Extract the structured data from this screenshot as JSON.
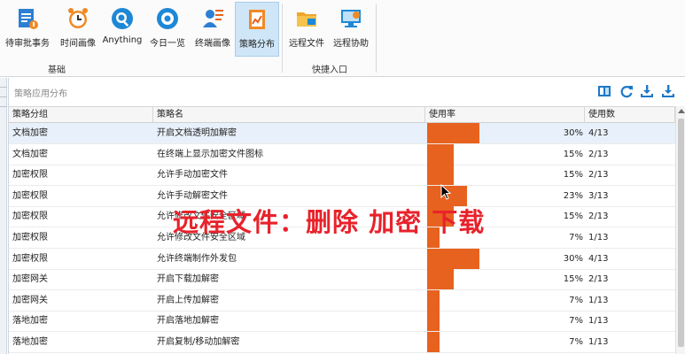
{
  "ribbon": {
    "buttons": [
      {
        "label": "待审批事务",
        "icon": "approval-tasks-icon"
      },
      {
        "label": "时间画像",
        "icon": "alarm-clock-icon"
      },
      {
        "label": "Anything",
        "icon": "search-document-icon"
      },
      {
        "label": "今日一览",
        "icon": "eye-icon"
      },
      {
        "label": "终端画像",
        "icon": "terminal-profile-icon"
      },
      {
        "label": "策略分布",
        "icon": "strategy-chart-icon"
      },
      {
        "label": "远程文件",
        "icon": "remote-folder-icon"
      },
      {
        "label": "远程协助",
        "icon": "remote-assist-icon"
      }
    ],
    "group_basic": "基础",
    "group_shortcut": "快捷入口"
  },
  "panel": {
    "title": "策略应用分布",
    "columns": [
      "策略分组",
      "策略名",
      "使用率",
      "使用数"
    ],
    "rows": [
      {
        "group": "文档加密",
        "name": "开启文档透明加解密",
        "rate": 0.3,
        "rate_label": "30%",
        "count": "4/13"
      },
      {
        "group": "文档加密",
        "name": "在终端上显示加密文件图标",
        "rate": 0.15,
        "rate_label": "15%",
        "count": "2/13"
      },
      {
        "group": "加密权限",
        "name": "允许手动加密文件",
        "rate": 0.15,
        "rate_label": "15%",
        "count": "2/13"
      },
      {
        "group": "加密权限",
        "name": "允许手动解密文件",
        "rate": 0.23,
        "rate_label": "23%",
        "count": "3/13"
      },
      {
        "group": "加密权限",
        "name": "允许修改文件安全区域",
        "rate": 0.15,
        "rate_label": "15%",
        "count": "2/13"
      },
      {
        "group": "加密权限",
        "name": "允许修改文件安全区域",
        "rate": 0.07,
        "rate_label": "7%",
        "count": "1/13"
      },
      {
        "group": "加密权限",
        "name": "允许终端制作外发包",
        "rate": 0.3,
        "rate_label": "30%",
        "count": "4/13"
      },
      {
        "group": "加密网关",
        "name": "开启下载加解密",
        "rate": 0.15,
        "rate_label": "15%",
        "count": "2/13"
      },
      {
        "group": "加密网关",
        "name": "开启上传加解密",
        "rate": 0.07,
        "rate_label": "7%",
        "count": "1/13"
      },
      {
        "group": "落地加密",
        "name": "开启落地加解密",
        "rate": 0.07,
        "rate_label": "7%",
        "count": "1/13"
      },
      {
        "group": "落地加密",
        "name": "开启复制/移动加解密",
        "rate": 0.07,
        "rate_label": "7%",
        "count": "1/13"
      }
    ]
  },
  "overlay_text": "远程文件：删除 加密 下载",
  "colors": {
    "accent": "#e8621f",
    "overlay": "#e8222b",
    "selected_row": "#e8f1fb",
    "active_button": "#cfe6f8"
  }
}
